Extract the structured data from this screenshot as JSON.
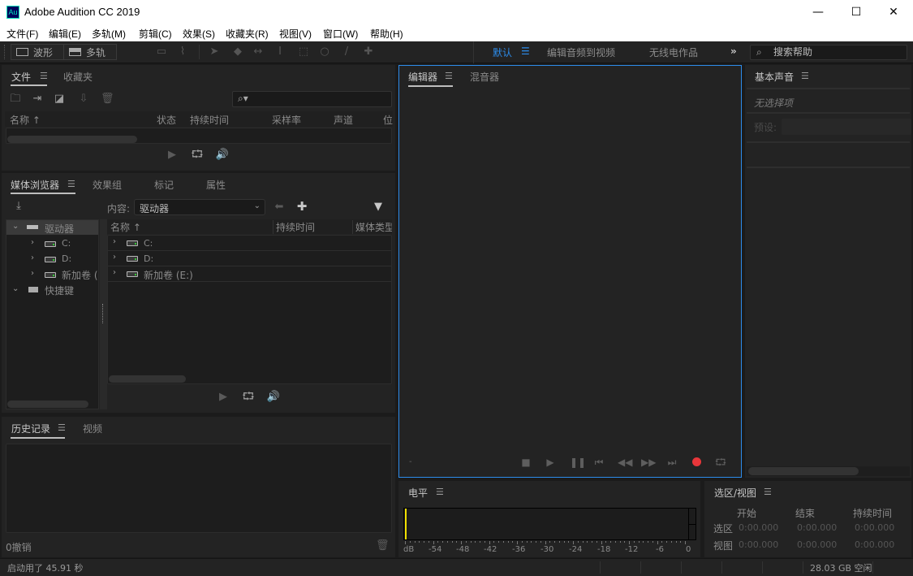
{
  "window": {
    "title": "Adobe Audition CC 2019",
    "app_icon": "Au",
    "controls": {
      "minimize": "—",
      "maximize": "☐",
      "close": "✕"
    }
  },
  "menu": [
    "文件(F)",
    "编辑(E)",
    "多轨(M)",
    "剪辑(C)",
    "效果(S)",
    "收藏夹(R)",
    "视图(V)",
    "窗口(W)",
    "帮助(H)"
  ],
  "toolbar": {
    "waveform_label": "波形",
    "multitrack_label": "多轨",
    "tools": [
      "spectral-frequency-icon",
      "pitch-display-icon",
      "move-tool-icon",
      "razor-tool-icon",
      "slip-tool-icon",
      "time-selection-icon",
      "marquee-icon",
      "lasso-icon",
      "brush-icon",
      "spot-healing-icon"
    ],
    "workspaces": [
      {
        "label": "默认",
        "active": true
      },
      {
        "label": "编辑音频到视频",
        "active": false
      },
      {
        "label": "无线电作品",
        "active": false
      }
    ],
    "more": "»",
    "search_help": "搜索帮助",
    "accent": "#2d8ceb"
  },
  "files_panel": {
    "tabs": [
      {
        "label": "文件",
        "active": true
      },
      {
        "label": "收藏夹",
        "active": false
      }
    ],
    "columns": [
      "名称 ↑",
      "状态",
      "持续时间",
      "采样率",
      "声道",
      "位"
    ],
    "search_placeholder": ""
  },
  "media_browser": {
    "tabs": [
      {
        "label": "媒体浏览器",
        "active": true
      },
      {
        "label": "效果组",
        "active": false
      },
      {
        "label": "标记",
        "active": false
      },
      {
        "label": "属性",
        "active": false
      }
    ],
    "content_label": "内容:",
    "content_value": "驱动器",
    "tree": [
      {
        "label": "驱动器",
        "level": 0,
        "expanded": true,
        "selected": true
      },
      {
        "label": "C:",
        "level": 1,
        "expanded": false
      },
      {
        "label": "D:",
        "level": 1,
        "expanded": false
      },
      {
        "label": "新加卷 (I",
        "level": 1,
        "expanded": false
      },
      {
        "label": "快捷键",
        "level": 0,
        "expanded": true
      }
    ],
    "columns": [
      "名称 ↑",
      "持续时间",
      "媒体类型"
    ],
    "rows": [
      "C:",
      "D:",
      "新加卷 (E:)"
    ]
  },
  "history_panel": {
    "tabs": [
      {
        "label": "历史记录",
        "active": true
      },
      {
        "label": "视频",
        "active": false
      }
    ],
    "undo_count": "0撤销"
  },
  "editor_panel": {
    "tabs": [
      {
        "label": "编辑器",
        "active": true
      },
      {
        "label": "混音器",
        "active": false
      }
    ],
    "time_readout": "-",
    "record_color": "#e8363a"
  },
  "essential_sound": {
    "title": "基本声音",
    "no_selection": "无选择项",
    "preset_label": "预设:"
  },
  "levels_panel": {
    "title": "电平",
    "scale_unit": "dB",
    "scale": [
      "-54",
      "-48",
      "-42",
      "-36",
      "-30",
      "-24",
      "-18",
      "-12",
      "-6",
      "0"
    ],
    "peak_color": "#f0e000"
  },
  "selection_view": {
    "title": "选区/视图",
    "headers": [
      "开始",
      "结束",
      "持续时间"
    ],
    "rows": [
      {
        "label": "选区",
        "start": "0:00.000",
        "end": "0:00.000",
        "duration": "0:00.000"
      },
      {
        "label": "视图",
        "start": "0:00.000",
        "end": "0:00.000",
        "duration": "0:00.000"
      }
    ]
  },
  "status": {
    "startup": "启动用了 45.91 秒",
    "disk_free": "28.03 GB 空闲"
  }
}
